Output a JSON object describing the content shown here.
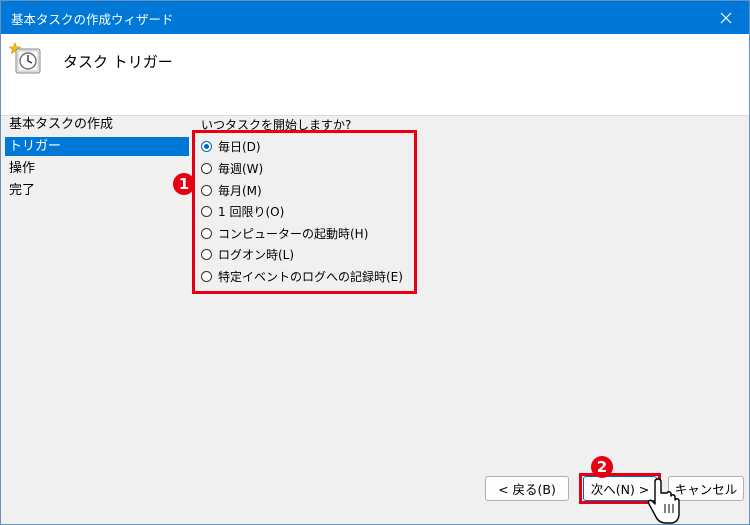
{
  "window": {
    "title": "基本タスクの作成ウィザード"
  },
  "header": {
    "title": "タスク トリガー"
  },
  "sidebar": {
    "items": [
      {
        "label": "基本タスクの作成",
        "selected": false
      },
      {
        "label": "トリガー",
        "selected": true
      },
      {
        "label": "操作",
        "selected": false
      },
      {
        "label": "完了",
        "selected": false
      }
    ]
  },
  "trigger": {
    "question": "いつタスクを開始しますか?",
    "options": [
      {
        "label": "毎日(D)",
        "checked": true
      },
      {
        "label": "毎週(W)",
        "checked": false
      },
      {
        "label": "毎月(M)",
        "checked": false
      },
      {
        "label": "1 回限り(O)",
        "checked": false
      },
      {
        "label": "コンピューターの起動時(H)",
        "checked": false
      },
      {
        "label": "ログオン時(L)",
        "checked": false
      },
      {
        "label": "特定イベントのログへの記録時(E)",
        "checked": false
      }
    ]
  },
  "annotations": {
    "badge1": "1",
    "badge2": "2",
    "color": "#e60012"
  },
  "buttons": {
    "back": "< 戻る(B)",
    "next": "次へ(N) >",
    "cancel": "キャンセル"
  },
  "icons": {
    "close": "close-icon",
    "task": "task-clock-icon",
    "cursor": "mouse-pointer-icon"
  }
}
